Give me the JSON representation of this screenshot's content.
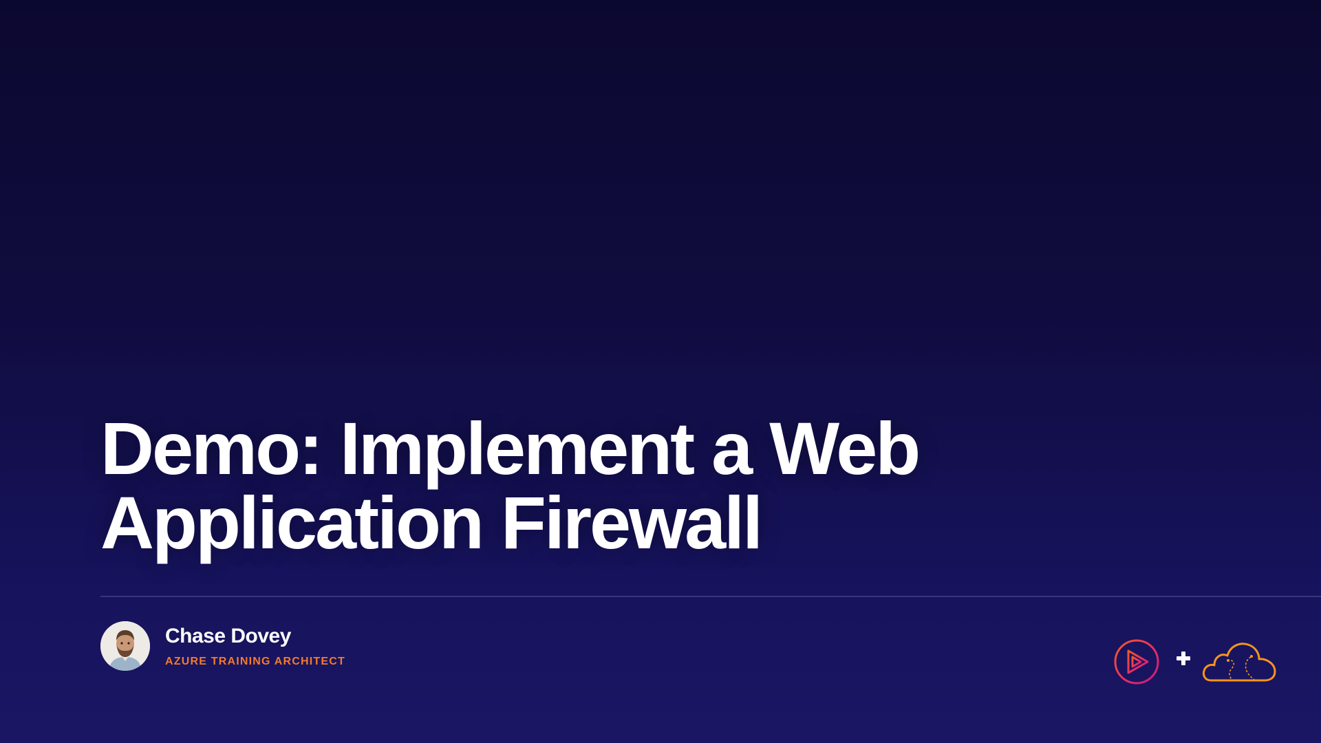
{
  "slide": {
    "title_line_1": "Demo: Implement a Web",
    "title_line_2": "Application Firewall"
  },
  "presenter": {
    "name": "Chase Dovey",
    "role": "AZURE TRAINING ARCHITECT"
  },
  "logos": {
    "left_icon": "pluralsight-play-icon",
    "separator_icon": "plus-icon",
    "right_icon": "a-cloud-guru-cloud-icon"
  },
  "colors": {
    "background_top": "#0b0830",
    "background_bottom": "#1a1664",
    "title_text": "#ffffff",
    "accent_orange": "#f47b2a",
    "accent_pink": "#e8335f"
  }
}
